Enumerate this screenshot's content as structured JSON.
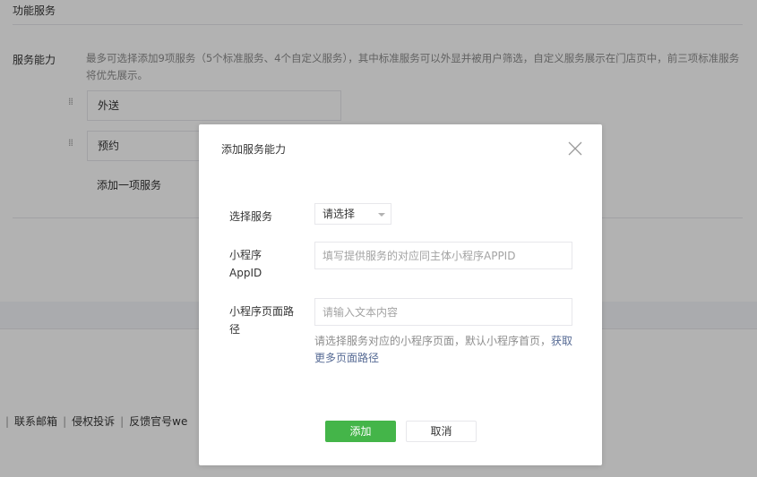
{
  "background": {
    "section_title": "功能服务",
    "capability_label": "服务能力",
    "capability_desc": "最多可选择添加9项服务（5个标准服务、4个自定义服务），其中标准服务可以外显并被用户筛选，自定义服务展示在门店页中，前三项标准服务将优先展示。",
    "services": [
      "外送",
      "预约"
    ],
    "add_service_label": "添加一项服务",
    "footer_links": [
      "联系邮箱",
      "侵权投诉",
      "反馈官号we"
    ]
  },
  "dialog": {
    "title": "添加服务能力",
    "select_label": "选择服务",
    "select_value": "请选择",
    "appid_label_line1": "小程序",
    "appid_label_line2": "AppID",
    "appid_placeholder": "填写提供服务的对应同主体小程序APPID",
    "path_label": "小程序页面路径",
    "path_placeholder": "请输入文本内容",
    "hint_text": "请选择服务对应的小程序页面，默认小程序首页，",
    "hint_link": "获取更多页面路径",
    "confirm_label": "添加",
    "cancel_label": "取消"
  },
  "colors": {
    "primary": "#44b549",
    "link": "#576b95",
    "border": "#e7e7eb"
  }
}
